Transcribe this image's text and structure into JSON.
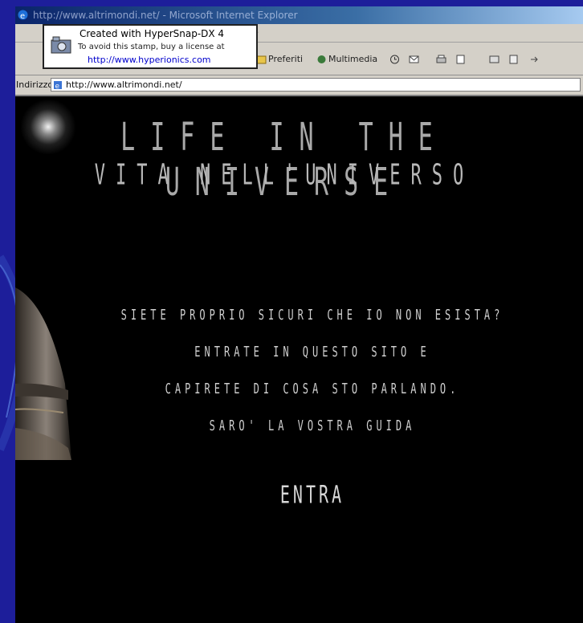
{
  "window": {
    "title": "http://www.altrimondi.net/ - Microsoft Internet Explorer"
  },
  "toolbar": {
    "favorites_label": "Preferiti",
    "multimedia_label": "Multimedia"
  },
  "address_bar": {
    "label": "Indirizzo",
    "url": "http://www.altrimondi.net/"
  },
  "stamp": {
    "line1": "Created with HyperSnap-DX 4",
    "line2": "To avoid this stamp, buy a license at",
    "line3": "http://www.hyperionics.com"
  },
  "page": {
    "title": "LIFE IN THE UNIVERSE",
    "subtitle": "VITA NELL'UNIVERSO",
    "message_lines": [
      "SIETE PROPRIO SICURI CHE IO NON ESISTA?",
      "ENTRATE IN QUESTO SITO E",
      "CAPIRETE DI COSA STO PARLANDO.",
      "SARO' LA VOSTRA GUIDA"
    ],
    "enter_label": "ENTRA"
  },
  "colors": {
    "slide_background": "#1d1e9a",
    "page_background": "#000000",
    "browser_chrome": "#d4d0c8"
  }
}
